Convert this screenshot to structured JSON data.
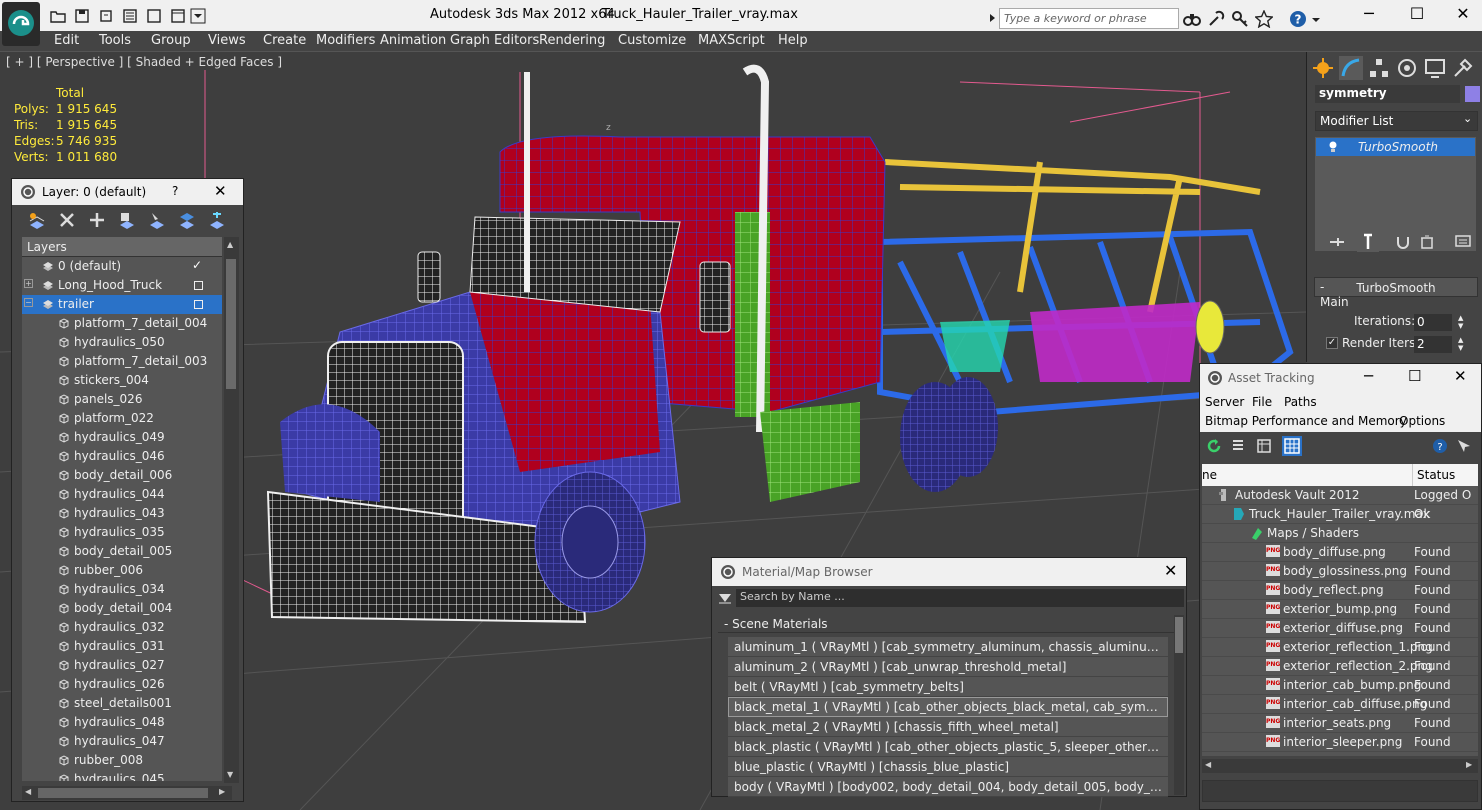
{
  "window": {
    "app_title": "Autodesk 3ds Max  2012 x64",
    "file_title": "Truck_Hauler_Trailer_vray.max",
    "search_placeholder": "Type a keyword or phrase",
    "minimize": "─",
    "maximize": "☐",
    "close": "✕"
  },
  "menubar": {
    "items": [
      "Edit",
      "Tools",
      "Group",
      "Views",
      "Create",
      "Modifiers",
      "Animation",
      "Graph Editors",
      "Rendering",
      "Customize",
      "MAXScript",
      "Help"
    ]
  },
  "viewport": {
    "label": "[ + ] [ Perspective ] [ Shaded + Edged Faces ]",
    "stats_header": "Total",
    "stats": [
      {
        "label": "Polys:",
        "value": "1 915 645"
      },
      {
        "label": "Tris:",
        "value": "1 915 645"
      },
      {
        "label": "Edges:",
        "value": "5 746 935"
      },
      {
        "label": "Verts:",
        "value": "1 011 680"
      }
    ],
    "axis_label": "z"
  },
  "layer_dialog": {
    "title": "Layer: 0 (default)",
    "help": "?",
    "close": "✕",
    "header": "Layers",
    "rows": [
      {
        "name": "0 (default)",
        "level": 0
      },
      {
        "name": "Long_Hood_Truck",
        "level": 0
      },
      {
        "name": "trailer",
        "level": 0,
        "selected": true
      },
      {
        "name": "platform_7_detail_004",
        "level": 1
      },
      {
        "name": "hydraulics_050",
        "level": 1
      },
      {
        "name": "platform_7_detail_003",
        "level": 1
      },
      {
        "name": "stickers_004",
        "level": 1
      },
      {
        "name": "panels_026",
        "level": 1
      },
      {
        "name": "platform_022",
        "level": 1
      },
      {
        "name": "hydraulics_049",
        "level": 1
      },
      {
        "name": "hydraulics_046",
        "level": 1
      },
      {
        "name": "body_detail_006",
        "level": 1
      },
      {
        "name": "hydraulics_044",
        "level": 1
      },
      {
        "name": "hydraulics_043",
        "level": 1
      },
      {
        "name": "hydraulics_035",
        "level": 1
      },
      {
        "name": "body_detail_005",
        "level": 1
      },
      {
        "name": "rubber_006",
        "level": 1
      },
      {
        "name": "hydraulics_034",
        "level": 1
      },
      {
        "name": "body_detail_004",
        "level": 1
      },
      {
        "name": "hydraulics_032",
        "level": 1
      },
      {
        "name": "hydraulics_031",
        "level": 1
      },
      {
        "name": "hydraulics_027",
        "level": 1
      },
      {
        "name": "hydraulics_026",
        "level": 1
      },
      {
        "name": "steel_details001",
        "level": 1
      },
      {
        "name": "hydraulics_048",
        "level": 1
      },
      {
        "name": "hydraulics_047",
        "level": 1
      },
      {
        "name": "rubber_008",
        "level": 1
      },
      {
        "name": "hydraulics_045",
        "level": 1
      }
    ]
  },
  "command_panel": {
    "object_name": "symmetry",
    "object_color": "#8e80e6",
    "modifier_list": "Modifier List",
    "modifier_stack_item": "TurboSmooth",
    "rollout_title": "TurboSmooth",
    "group_main": "Main",
    "iterations_label": "Iterations:",
    "iterations_value": "0",
    "render_iters_label": "Render Iters:",
    "render_iters_value": "2"
  },
  "asset_tracking": {
    "title": "Asset Tracking",
    "menu": [
      "Server",
      "File",
      "Paths",
      "Bitmap Performance and Memory",
      "Options"
    ],
    "col_name": "ne",
    "col_status": "Status",
    "rows": [
      {
        "name": "Autodesk Vault 2012",
        "status": "Logged O",
        "level": 0,
        "icon": "vault"
      },
      {
        "name": "Truck_Hauler_Trailer_vray.max",
        "status": "Ok",
        "level": 1,
        "icon": "max"
      },
      {
        "name": "Maps / Shaders",
        "status": "",
        "level": 2,
        "icon": "maps"
      },
      {
        "name": "body_diffuse.png",
        "status": "Found",
        "level": 3,
        "icon": "png"
      },
      {
        "name": "body_glossiness.png",
        "status": "Found",
        "level": 3,
        "icon": "png"
      },
      {
        "name": "body_reflect.png",
        "status": "Found",
        "level": 3,
        "icon": "png"
      },
      {
        "name": "exterior_bump.png",
        "status": "Found",
        "level": 3,
        "icon": "png"
      },
      {
        "name": "exterior_diffuse.png",
        "status": "Found",
        "level": 3,
        "icon": "png"
      },
      {
        "name": "exterior_reflection_1.png",
        "status": "Found",
        "level": 3,
        "icon": "png"
      },
      {
        "name": "exterior_reflection_2.png",
        "status": "Found",
        "level": 3,
        "icon": "png"
      },
      {
        "name": "interior_cab_bump.png",
        "status": "Found",
        "level": 3,
        "icon": "png"
      },
      {
        "name": "interior_cab_diffuse.png",
        "status": "Found",
        "level": 3,
        "icon": "png"
      },
      {
        "name": "interior_seats.png",
        "status": "Found",
        "level": 3,
        "icon": "png"
      },
      {
        "name": "interior_sleeper.png",
        "status": "Found",
        "level": 3,
        "icon": "png"
      }
    ]
  },
  "material_browser": {
    "title": "Material/Map Browser",
    "search_placeholder": "Search by Name ...",
    "section": "- Scene Materials",
    "rows": [
      "aluminum_1  ( VRayMtl )  [cab_symmetry_aluminum, chassis_aluminum, other_objects_aluminum...",
      "aluminum_2  ( VRayMtl )  [cab_unwrap_threshold_metal]",
      "belt  ( VRayMtl )  [cab_symmetry_belts]",
      "black_metal_1  ( VRayMtl )  [cab_other_objects_black_metal, cab_symmetry_black_metal...",
      "black_metal_2  ( VRayMtl )  [chassis_fifth_wheel_metal]",
      "black_plastic  ( VRayMtl )  [cab_other_objects_plastic_5, sleeper_other_objects_plastic...",
      "blue_plastic  ( VRayMtl )  [chassis_blue_plastic]",
      "body  ( VRayMtl )  [body002, body_detail_004, body_detail_005, body_detail_006, p..."
    ],
    "selected_index": 3
  }
}
